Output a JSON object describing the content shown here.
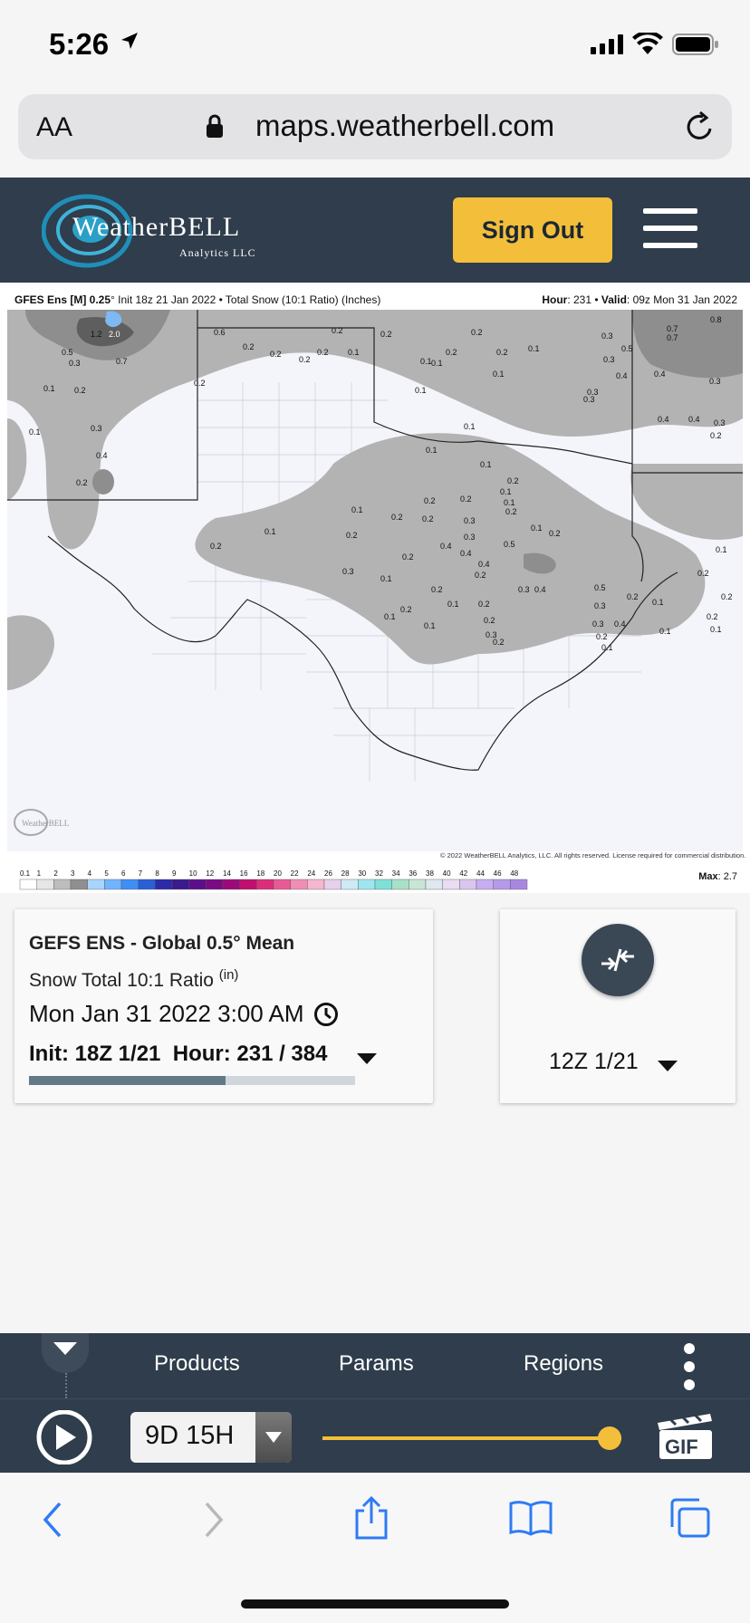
{
  "status_bar": {
    "time": "5:26"
  },
  "address_bar": {
    "text_size_label": "AA",
    "url": "maps.weatherbell.com"
  },
  "header": {
    "logo_text": "WeatherBELL",
    "logo_subtext": "Analytics LLC",
    "sign_out_label": "Sign Out"
  },
  "map": {
    "title_model": "GFES Ens [M] 0.25",
    "title_rest": "° Init 18z 21 Jan 2022 • Total Snow (10:1 Ratio) (Inches)",
    "valid_hour_label": "Hour",
    "valid_hour_value": ": 231 • ",
    "valid_label": "Valid",
    "valid_value": ": 09z Mon 31 Jan 2022",
    "copyright": "© 2022 WeatherBELL Analytics, LLC. All rights reserved. License required for commercial distribution.",
    "max_label": "Max",
    "max_value": ": 2.7",
    "scale_ticks": [
      "0.1",
      "1",
      "2",
      "3",
      "4",
      "5",
      "6",
      "7",
      "8",
      "9",
      "10",
      "12",
      "14",
      "16",
      "18",
      "20",
      "22",
      "24",
      "26",
      "28",
      "30",
      "32",
      "34",
      "36",
      "38",
      "40",
      "42",
      "44",
      "46",
      "48"
    ],
    "scale_colors": [
      "#ffffff",
      "#e6e6e6",
      "#bdbdbd",
      "#8f8f8f",
      "#a8d4ff",
      "#6fb4ff",
      "#3e8ef5",
      "#2a5fd6",
      "#2b2aa8",
      "#3a1a8c",
      "#5b108a",
      "#7a0b85",
      "#9c0a7a",
      "#c0106f",
      "#dc2d7b",
      "#e85a95",
      "#f08db5",
      "#f5b6cf",
      "#e6d1ec",
      "#cdebf5",
      "#9ee6ee",
      "#7fe0d8",
      "#a8e0c8",
      "#c8e6d5",
      "#dfe8ee",
      "#eadcf2",
      "#dac6ee",
      "#c6aef0",
      "#b599ea",
      "#a887e2"
    ],
    "labels": [
      "1.2",
      "2.0",
      "0.6",
      "0.5",
      "0.3",
      "0.7",
      "0.1",
      "0.2",
      "0.2",
      "0.1",
      "0.3",
      "0.4",
      "0.2",
      "0.2",
      "0.2",
      "0.2",
      "0.2",
      "0.1",
      "0.2",
      "0.2",
      "0.1",
      "0.1",
      "0.2",
      "0.2",
      "0.1",
      "0.1",
      "0.2",
      "0.1",
      "0.3",
      "0.3",
      "0.5",
      "0.3",
      "0.4",
      "0.3",
      "0.7",
      "0.7",
      "0.8",
      "0.4",
      "0.4",
      "0.4",
      "0.3",
      "0.3",
      "0.2",
      "0.1",
      "0.1",
      "0.1",
      "0.2",
      "0.2",
      "0.2",
      "0.1",
      "0.1",
      "0.2",
      "0.2",
      "0.3",
      "0.1",
      "0.2",
      "0.3",
      "0.4",
      "0.4",
      "0.5",
      "0.4",
      "0.2",
      "0.1",
      "0.2",
      "0.3",
      "0.4",
      "0.2",
      "0.5",
      "0.3",
      "0.2",
      "0.2",
      "0.3",
      "0.4",
      "0.2",
      "0.1",
      "0.1",
      "0.2",
      "0.1",
      "0.2",
      "0.2",
      "0.1",
      "0.1",
      "0.1",
      "0.2",
      "0.2",
      "0.3",
      "0.3",
      "0.2",
      "0.1",
      "0.2",
      "0.2",
      "0.1",
      "0.2",
      "0.1",
      "0.1"
    ]
  },
  "info_card": {
    "model": "GEFS ENS - Global 0.5° Mean",
    "parameter": "Snow Total 10:1 Ratio",
    "parameter_unit": "(in)",
    "valid_time": "Mon Jan 31 2022 3:00 AM",
    "init_label": "Init: 18Z 1/21",
    "hour_label": "Hour: 231 / 384",
    "progress_fraction": 0.6016
  },
  "side_card": {
    "run": "12Z 1/21"
  },
  "nav": {
    "products": "Products",
    "params": "Params",
    "regions": "Regions"
  },
  "player": {
    "duration": "9D 15H",
    "slider_fraction": 1.0,
    "gif_label": "GIF"
  },
  "colors": {
    "header_bg": "#2f3d4c",
    "accent_yellow": "#f3bf3a",
    "ios_blue": "#2f7bf5"
  }
}
